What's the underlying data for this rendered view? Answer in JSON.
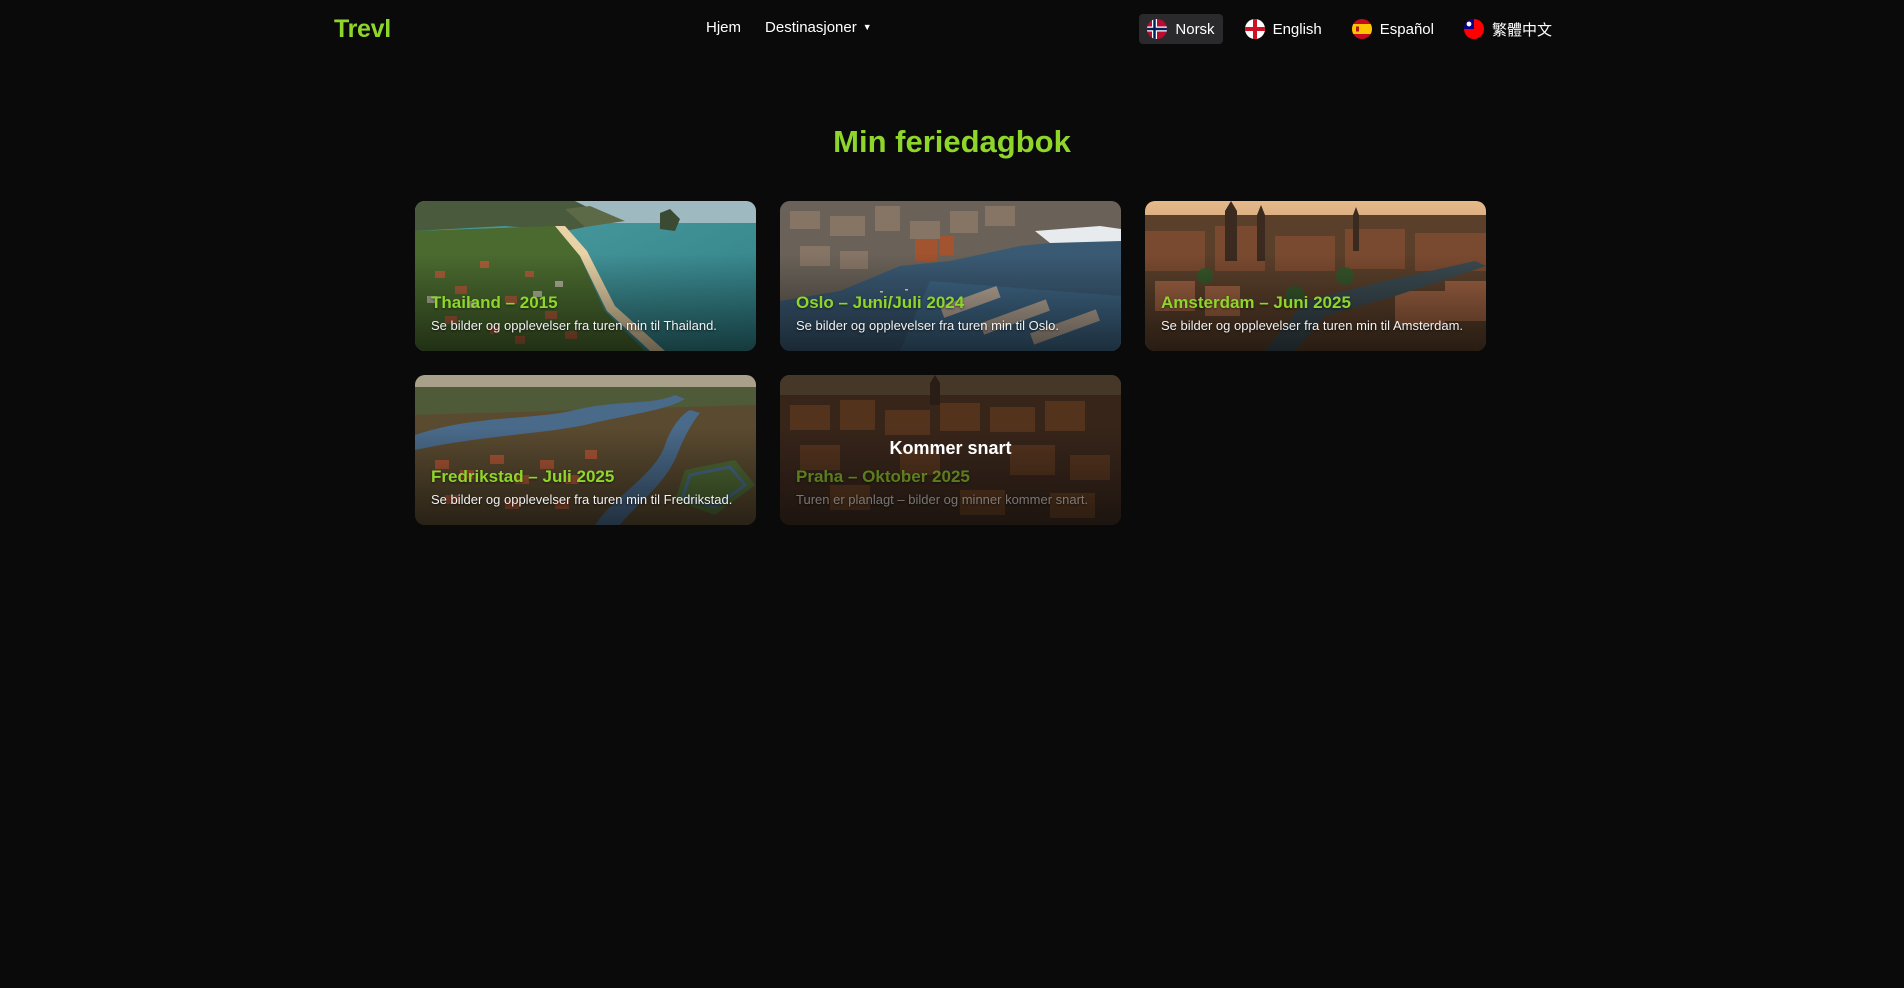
{
  "brand": "Trevl",
  "nav": {
    "home": "Hjem",
    "destinations": "Destinasjoner",
    "destinations_caret": "▼"
  },
  "languages": [
    {
      "label": "Norsk",
      "flag": "norway-flag-icon",
      "active": true
    },
    {
      "label": "English",
      "flag": "england-flag-icon",
      "active": false
    },
    {
      "label": "Español",
      "flag": "spain-flag-icon",
      "active": false
    },
    {
      "label": "繁體中文",
      "flag": "taiwan-flag-icon",
      "active": false
    }
  ],
  "page_title": "Min feriedagbok",
  "cards": [
    {
      "title": "Thailand – 2015",
      "desc": "Se bilder og opplevelser fra turen min til Thailand."
    },
    {
      "title": "Oslo – Juni/Juli 2024",
      "desc": "Se bilder og opplevelser fra turen min til Oslo."
    },
    {
      "title": "Amsterdam – Juni 2025",
      "desc": "Se bilder og opplevelser fra turen min til Amsterdam."
    },
    {
      "title": "Fredrikstad – Juli 2025",
      "desc": "Se bilder og opplevelser fra turen min til Fredrikstad."
    },
    {
      "title": "Praha – Oktober 2025",
      "desc": "Turen er planlagt – bilder og minner kommer snart.",
      "overlay": "Kommer snart"
    }
  ],
  "colors": {
    "accent": "#8fd62a",
    "background": "#0a0a0b",
    "active_lang_bg": "#2a2a2d"
  }
}
